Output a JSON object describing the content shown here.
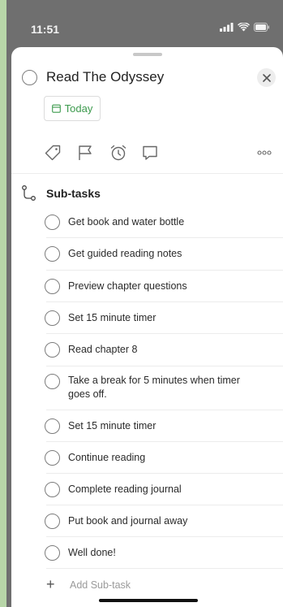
{
  "status_bar": {
    "time": "11:51"
  },
  "task": {
    "title": "Read The Odyssey"
  },
  "due": {
    "label": "Today",
    "color": "#3c9a4d"
  },
  "toolbar": {
    "icons": [
      "tag-icon",
      "flag-icon",
      "alarm-icon",
      "comment-icon",
      "more-icon"
    ]
  },
  "subtasks": {
    "header": "Sub-tasks",
    "items": [
      {
        "label": "Get book and water bottle"
      },
      {
        "label": "Get guided reading notes"
      },
      {
        "label": "Preview chapter questions"
      },
      {
        "label": "Set 15 minute timer"
      },
      {
        "label": "Read chapter 8"
      },
      {
        "label": "Take a break for 5 minutes when timer goes off."
      },
      {
        "label": "Set 15 minute timer"
      },
      {
        "label": "Continue reading"
      },
      {
        "label": "Complete reading journal"
      },
      {
        "label": "Put book and journal away"
      },
      {
        "label": "Well done!"
      }
    ],
    "add_label": "Add Sub-task"
  }
}
